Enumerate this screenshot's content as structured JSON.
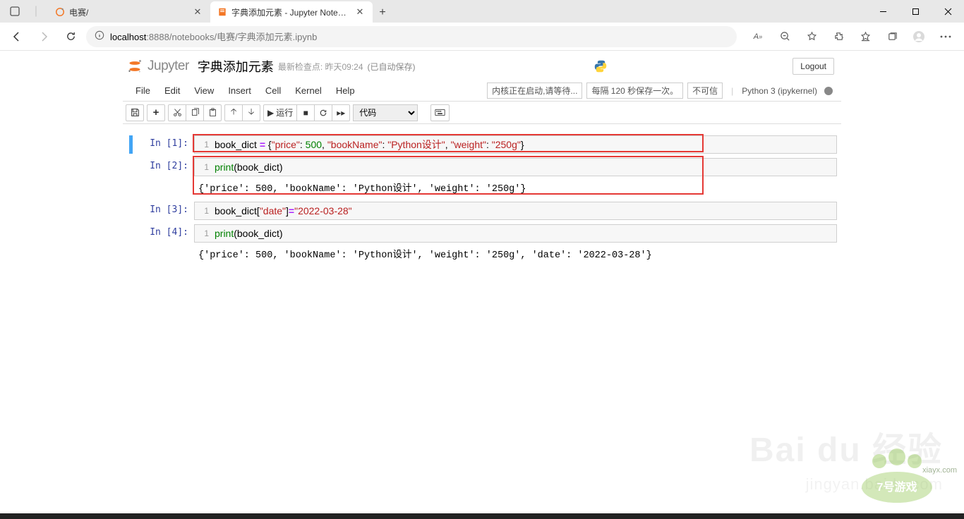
{
  "browser": {
    "tabs": [
      {
        "title": "电赛/",
        "active": false
      },
      {
        "title": "字典添加元素 - Jupyter Noteboo",
        "active": true
      }
    ],
    "url_host": "localhost",
    "url_port": ":8888",
    "url_path": "/notebooks/电赛/字典添加元素.ipynb"
  },
  "header": {
    "logo_text": "Jupyter",
    "notebook_title": "字典添加元素",
    "checkpoint": "最新检查点: 昨天09:24",
    "autosave": "(已自动保存)",
    "logout": "Logout"
  },
  "menubar": {
    "items": [
      "File",
      "Edit",
      "View",
      "Insert",
      "Cell",
      "Kernel",
      "Help"
    ],
    "status_boxes": [
      "内核正在启动,请等待...",
      "每隔 120 秒保存一次。",
      "不可信"
    ],
    "kernel_name": "Python 3 (ipykernel)"
  },
  "toolbar": {
    "run_label": "运行",
    "cell_type": "代码"
  },
  "cells": [
    {
      "prompt": "In [1]:",
      "code_html": "book_dict <span class='c-op'>=</span> {<span class='c-str'>\"price\"</span>: <span class='c-num'>500</span>, <span class='c-str'>\"bookName\"</span>: <span class='c-str'>\"Python设计\"</span>, <span class='c-str'>\"weight\"</span>: <span class='c-str'>\"250g\"</span>}",
      "output": null,
      "selected": true
    },
    {
      "prompt": "In [2]:",
      "code_html": "<span class='c-fn'>print</span>(book_dict)",
      "output": "{'price': 500, 'bookName': 'Python设计', 'weight': '250g'}",
      "selected": false
    },
    {
      "prompt": "In [3]:",
      "code_html": "book_dict[<span class='c-str'>\"date\"</span>]<span class='c-op'>=</span><span class='c-str'>\"2022-03-28\"</span>",
      "output": null,
      "selected": false
    },
    {
      "prompt": "In [4]:",
      "code_html": "<span class='c-fn'>print</span>(book_dict)",
      "output": "{'price': 500, 'bookName': 'Python设计', 'weight': '250g', 'date': '2022-03-28'}",
      "selected": false
    }
  ],
  "watermark": {
    "brand": "Bai du 经验",
    "sub": "jingyan.baidu.com",
    "site": "xiayx.com"
  }
}
